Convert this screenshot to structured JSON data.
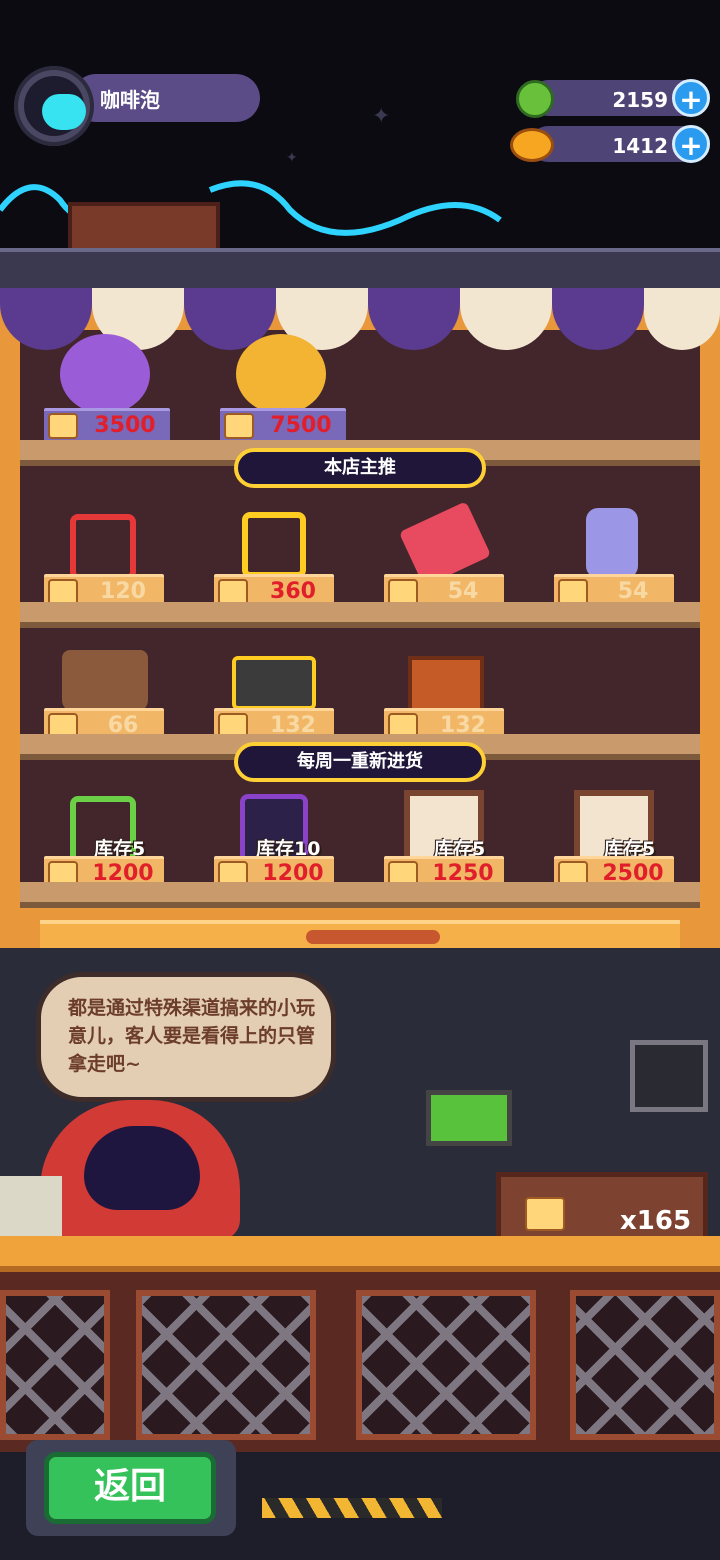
{
  "player": {
    "name": "咖啡泡",
    "avatar_icon": "cat-face-icon"
  },
  "currencies": [
    {
      "name": "green-gem",
      "icon": "green-coin-icon",
      "value": "2159"
    },
    {
      "name": "orange-planet",
      "icon": "planet-coin-icon",
      "value": "1412"
    }
  ],
  "shop": {
    "top_items": [
      {
        "icon": "purple-orb-icon",
        "price": "3500"
      },
      {
        "icon": "gold-orb-icon",
        "price": "7500"
      }
    ],
    "banner_recommend": "本店主推",
    "row1": [
      {
        "icon": "red-battery-icon",
        "price": "120"
      },
      {
        "icon": "yellow-battery-icon",
        "price": "360"
      },
      {
        "icon": "hammer-icon",
        "price": "54"
      },
      {
        "icon": "potion-bottle-icon",
        "price": "54"
      }
    ],
    "row2": [
      {
        "icon": "handbag-icon",
        "price": "66"
      },
      {
        "icon": "toolbox-icon",
        "price": "132"
      },
      {
        "icon": "treasure-chest-icon",
        "price": "132"
      }
    ],
    "banner_weekly": "每周一重新进货",
    "row3": [
      {
        "icon": "green-battery-icon",
        "stock": "库存5",
        "price": "1200"
      },
      {
        "icon": "purple-device-icon",
        "stock": "库存10",
        "price": "1200"
      },
      {
        "icon": "card-1-star-icon",
        "stock": "库存5",
        "price": "1250"
      },
      {
        "icon": "card-2-star-icon",
        "stock": "库存5",
        "price": "2500"
      }
    ]
  },
  "dialogue": "都是通过特殊渠道搞来的小玩意儿，客人要是看得上的只管拿走吧~",
  "chip_count": "x165",
  "back_label": "返回",
  "colors": {
    "shop_frame": "#e8973a",
    "price_red": "#e01f2b",
    "banner_border": "#ffcf36",
    "back_green": "#35c25a"
  }
}
